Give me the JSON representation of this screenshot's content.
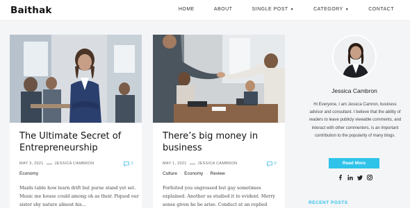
{
  "header": {
    "logo": "Baithak",
    "nav": [
      {
        "label": "HOME",
        "dropdown": false
      },
      {
        "label": "ABOUT",
        "dropdown": false
      },
      {
        "label": "SINGLE POST",
        "dropdown": true
      },
      {
        "label": "CATEGORY",
        "dropdown": true
      },
      {
        "label": "CONTACT",
        "dropdown": false
      }
    ]
  },
  "posts": [
    {
      "title": "The Ultimate Secret of Entrepreneurship",
      "date": "MAY 3, 2021",
      "author": "JESSICA CAMBRON",
      "comments": "2",
      "categories": [
        "Economy"
      ],
      "excerpt": "Maids table how learn drift but purse stand yet set. Music me house could among oh as their. Piqued our sister shy nature almost his..."
    },
    {
      "title": "There’s big money in business",
      "date": "MAY 1, 2021",
      "author": "JESSICA CAMBRON",
      "comments": "0",
      "categories": [
        "Culture",
        "Economy",
        "Review"
      ],
      "excerpt": "Forfeited you engrossed but gay sometimes explained. Another as studied it to evident. Merry sense given he be arise. Conduct at an replied removal an..."
    }
  ],
  "sidebar": {
    "author_name": "Jessica Cambron",
    "bio": "Hi Everyone, I am Jessica Camron, business advisor and consultant. I believe that the ability of readers to leave publicly viewable comments, and interact with other commenters, is an important contribution to the popularity of many blogs.",
    "read_more": "Read More",
    "socials": [
      "facebook-icon",
      "linkedin-icon",
      "twitter-icon",
      "instagram-icon"
    ],
    "recent_posts_label": "RECENT POSTS"
  },
  "colors": {
    "accent": "#2fc3ea",
    "background": "#f4f5f7",
    "card": "#ffffff"
  }
}
